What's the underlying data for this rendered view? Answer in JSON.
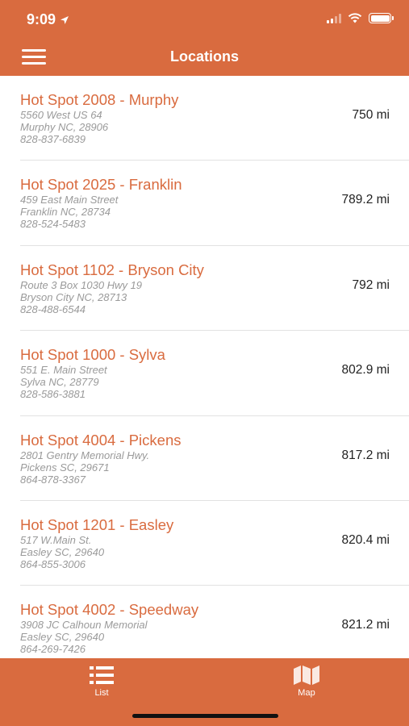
{
  "status_bar": {
    "time": "9:09"
  },
  "nav": {
    "title": "Locations"
  },
  "locations": [
    {
      "name": "Hot Spot 2008 - Murphy",
      "line1": "5560 West US 64",
      "line2": "Murphy NC, 28906",
      "phone": "828-837-6839",
      "distance": "750 mi"
    },
    {
      "name": "Hot Spot 2025 - Franklin",
      "line1": "459 East Main Street",
      "line2": "Franklin NC, 28734",
      "phone": "828-524-5483",
      "distance": "789.2 mi"
    },
    {
      "name": "Hot Spot 1102 - Bryson City",
      "line1": "Route 3 Box 1030 Hwy 19",
      "line2": "Bryson City NC, 28713",
      "phone": "828-488-6544",
      "distance": "792 mi"
    },
    {
      "name": "Hot Spot 1000 - Sylva",
      "line1": "551 E. Main Street",
      "line2": "Sylva NC, 28779",
      "phone": "828-586-3881",
      "distance": "802.9 mi"
    },
    {
      "name": "Hot Spot 4004 - Pickens",
      "line1": "2801 Gentry Memorial Hwy.",
      "line2": "Pickens SC, 29671",
      "phone": "864-878-3367",
      "distance": "817.2 mi"
    },
    {
      "name": "Hot Spot 1201 - Easley",
      "line1": "517 W.Main St.",
      "line2": "Easley SC, 29640",
      "phone": "864-855-3006",
      "distance": "820.4 mi"
    },
    {
      "name": "Hot Spot 4002 - Speedway",
      "line1": "3908 JC Calhoun Memorial",
      "line2": "Easley SC, 29640",
      "phone": "864-269-7426",
      "distance": "821.2 mi"
    }
  ],
  "tabs": {
    "list_label": "List",
    "map_label": "Map"
  },
  "colors": {
    "brand": "#d96b3f",
    "address_text": "#9a9a9a",
    "distance_text": "#222222"
  },
  "icons": {
    "menu": "hamburger-menu-icon",
    "list": "list-icon",
    "map": "map-icon",
    "location": "location-arrow-icon"
  }
}
